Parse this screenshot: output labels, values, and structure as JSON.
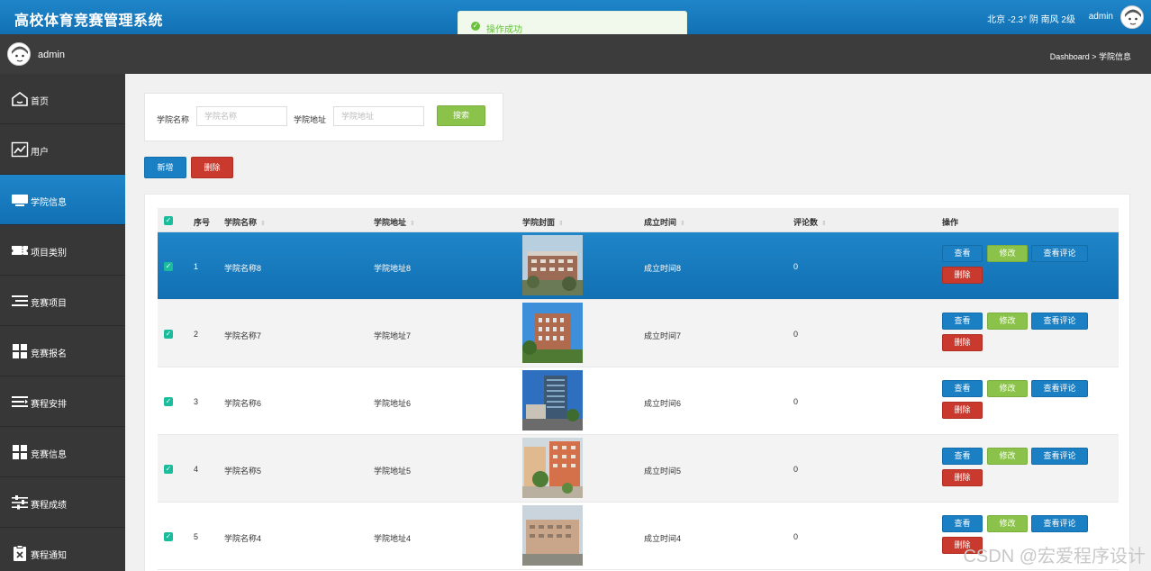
{
  "app": {
    "title": "高校体育竞赛管理系统"
  },
  "topbar": {
    "weather": "北京 -2.3° 阴 南风 2级",
    "user": "admin"
  },
  "toast": {
    "message": "操作成功"
  },
  "secondbar": {
    "user": "admin",
    "breadcrumb": "Dashboard > 学院信息"
  },
  "sidebar": {
    "items": [
      {
        "label": "首页",
        "icon": "home-icon"
      },
      {
        "label": "用户",
        "icon": "chart-line-icon"
      },
      {
        "label": "学院信息",
        "icon": "monitor-icon",
        "active": true
      },
      {
        "label": "项目类别",
        "icon": "ticket-icon"
      },
      {
        "label": "竞赛项目",
        "icon": "list-icon"
      },
      {
        "label": "竞赛报名",
        "icon": "grid-icon"
      },
      {
        "label": "赛程安排",
        "icon": "list-arrow-icon"
      },
      {
        "label": "竞赛信息",
        "icon": "grid-icon"
      },
      {
        "label": "赛程成绩",
        "icon": "sliders-icon"
      },
      {
        "label": "赛程通知",
        "icon": "clipboard-icon"
      }
    ]
  },
  "search": {
    "name_label": "学院名称",
    "name_placeholder": "学院名称",
    "address_label": "学院地址",
    "address_placeholder": "学院地址",
    "button": "搜索"
  },
  "actions": {
    "add": "新增",
    "delete": "删除"
  },
  "table": {
    "headers": {
      "index": "序号",
      "name": "学院名称",
      "address": "学院地址",
      "cover": "学院封面",
      "founded": "成立时间",
      "reviews": "评论数",
      "ops": "操作"
    },
    "op_labels": {
      "view": "查看",
      "edit": "修改",
      "comments": "查看评论",
      "delete": "删除"
    },
    "rows": [
      {
        "index": "1",
        "name": "学院名称8",
        "address": "学院地址8",
        "founded": "成立时间8",
        "reviews": "0"
      },
      {
        "index": "2",
        "name": "学院名称7",
        "address": "学院地址7",
        "founded": "成立时间7",
        "reviews": "0"
      },
      {
        "index": "3",
        "name": "学院名称6",
        "address": "学院地址6",
        "founded": "成立时间6",
        "reviews": "0"
      },
      {
        "index": "4",
        "name": "学院名称5",
        "address": "学院地址5",
        "founded": "成立时间5",
        "reviews": "0"
      },
      {
        "index": "5",
        "name": "学院名称4",
        "address": "学院地址4",
        "founded": "成立时间4",
        "reviews": "0"
      }
    ]
  },
  "watermark": "CSDN @宏爱程序设计",
  "colors": {
    "primary": "#1a7fc3",
    "success": "#8bc34a",
    "danger": "#c9392d",
    "sidebar": "#373737",
    "checkbox": "#1abc9c"
  }
}
